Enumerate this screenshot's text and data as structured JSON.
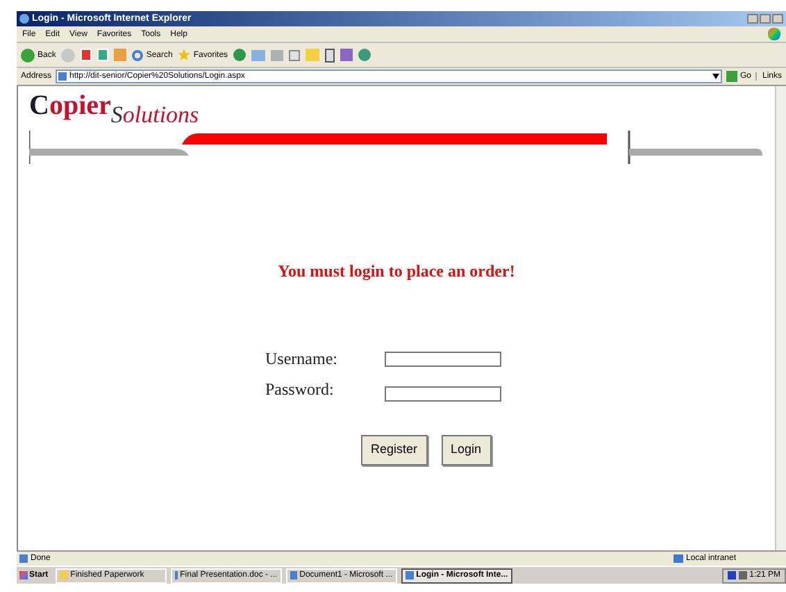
{
  "window": {
    "title": "Login - Microsoft Internet Explorer"
  },
  "menu": [
    "File",
    "Edit",
    "View",
    "Favorites",
    "Tools",
    "Help"
  ],
  "toolbar": {
    "back": "Back",
    "search": "Search",
    "favorites": "Favorites"
  },
  "address_bar": {
    "label": "Address",
    "value": "http://dit-senior/Copier%20Solutions/Login.aspx",
    "go": "Go",
    "links": "Links"
  },
  "page": {
    "logo": {
      "main": "Copier",
      "sub": "Solutions"
    },
    "message": "You must login to place an order!",
    "fields": [
      {
        "label": "Username:"
      },
      {
        "label": "Password:"
      }
    ],
    "buttons": [
      "Register",
      "Login"
    ]
  },
  "status_bar": {
    "text": "Done",
    "zone": "Local intranet"
  },
  "taskbar": {
    "start": "Start",
    "items": [
      {
        "label": "Finished Paperwork",
        "selected": false
      },
      {
        "label": "Final Presentation.doc - ...",
        "selected": false
      },
      {
        "label": "Document1 - Microsoft ...",
        "selected": false
      },
      {
        "label": "Login - Microsoft Inte...",
        "selected": true
      }
    ],
    "clock": "1:21 PM"
  }
}
